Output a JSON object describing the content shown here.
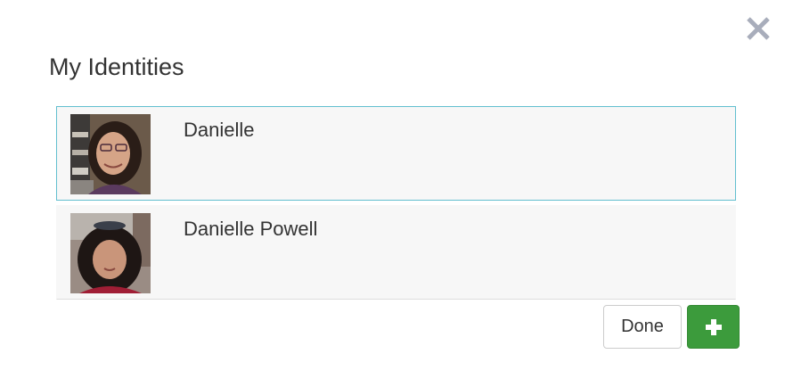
{
  "dialog": {
    "title": "My Identities",
    "close_icon": "close-icon",
    "accent_color": "#62bfcf"
  },
  "identities": [
    {
      "name": "Danielle",
      "selected": true,
      "avatar": "user-photo"
    },
    {
      "name": "Danielle Powell",
      "selected": false,
      "avatar": "user-photo"
    }
  ],
  "footer": {
    "done_label": "Done",
    "add_icon": "plus-icon",
    "add_button_color": "#3c9b3c"
  }
}
